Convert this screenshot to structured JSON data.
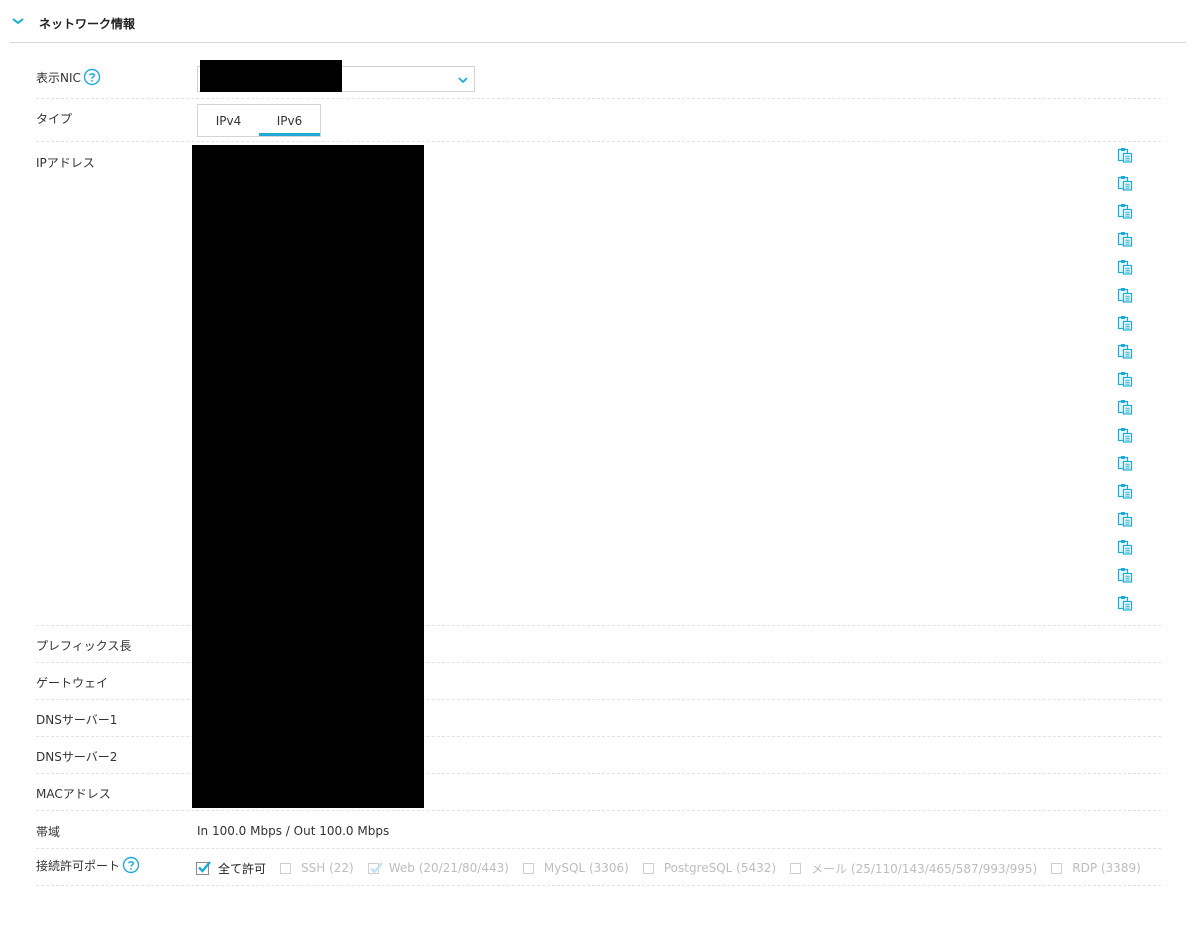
{
  "section": {
    "title": "ネットワーク情報"
  },
  "rows": {
    "nic_label": "表示NIC",
    "type_label": "タイプ",
    "ip_label": "IPアドレス",
    "prefix_label": "プレフィックス長",
    "gateway_label": "ゲートウェイ",
    "dns1_label": "DNSサーバー1",
    "dns2_label": "DNSサーバー2",
    "mac_label": "MACアドレス",
    "bandwidth_label": "帯域",
    "ports_label": "接続許可ポート"
  },
  "tabs": [
    {
      "label": "IPv4",
      "active": false
    },
    {
      "label": "IPv6",
      "active": true
    }
  ],
  "bandwidth_value": "In 100.0 Mbps / Out 100.0 Mbps",
  "ports": [
    {
      "label": "全て許可",
      "checked": true,
      "enabled": true
    },
    {
      "label": "SSH (22)",
      "checked": false,
      "enabled": false
    },
    {
      "label": "Web (20/21/80/443)",
      "checked": true,
      "enabled": false
    },
    {
      "label": "MySQL (3306)",
      "checked": false,
      "enabled": false
    },
    {
      "label": "PostgreSQL (5432)",
      "checked": false,
      "enabled": false
    },
    {
      "label": "メール (25/110/143/465/587/993/995)",
      "checked": false,
      "enabled": false
    },
    {
      "label": "RDP (3389)",
      "checked": false,
      "enabled": false
    }
  ],
  "ip_address_count": 17,
  "colors": {
    "accent": "#1fa9d6",
    "redaction": "#000000"
  },
  "icons": {
    "collapse": "chevron-down-icon",
    "help": "help-circle-icon",
    "copy": "clipboard-copy-icon"
  }
}
